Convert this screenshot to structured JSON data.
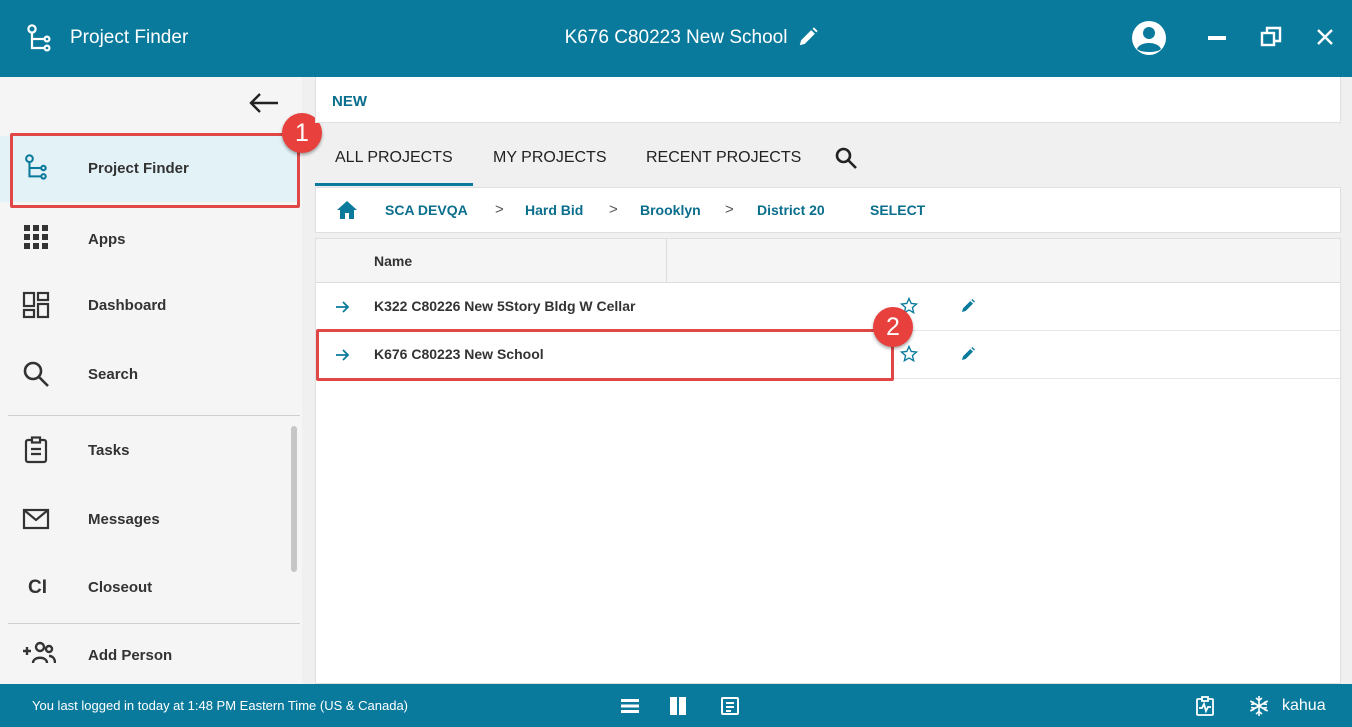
{
  "titlebar": {
    "app_name": "Project Finder",
    "project_title": "K676 C80223 New School",
    "icons": [
      "project-finder-icon",
      "pencil-icon",
      "user-avatar-icon",
      "minimize-icon",
      "restore-icon",
      "close-icon"
    ]
  },
  "sidebar": {
    "items": [
      {
        "label": "Project Finder",
        "icon": "project-finder-icon",
        "active": true
      },
      {
        "label": "Apps",
        "icon": "apps-grid-icon"
      },
      {
        "label": "Dashboard",
        "icon": "dashboard-icon"
      },
      {
        "label": "Search",
        "icon": "search-icon"
      },
      {
        "label": "Tasks",
        "icon": "clipboard-icon"
      },
      {
        "label": "Messages",
        "icon": "envelope-icon"
      },
      {
        "label": "Closeout",
        "icon": "closeout-icon",
        "icon_text": "CI"
      },
      {
        "label": "Add Person",
        "icon": "add-person-icon"
      }
    ]
  },
  "annotations": {
    "badge_1": "1",
    "badge_2": "2",
    "color": "#e04848"
  },
  "main": {
    "new_button": "NEW",
    "tabs": [
      {
        "label": "ALL PROJECTS",
        "active": true
      },
      {
        "label": "MY PROJECTS"
      },
      {
        "label": "RECENT PROJECTS"
      }
    ],
    "breadcrumb": {
      "items": [
        "SCA DEVQA",
        "Hard Bid",
        "Brooklyn",
        "District 20"
      ],
      "separator": ">",
      "select_label": "SELECT"
    },
    "grid": {
      "column_name": "Name",
      "rows": [
        {
          "name": "K322 C80226 New 5Story Bldg W Cellar"
        },
        {
          "name": "K676 C80223 New School"
        }
      ]
    }
  },
  "statusbar": {
    "login_text": "You last logged in today at 1:48 PM Eastern Time (US & Canada)",
    "brand": "kahua"
  },
  "colors": {
    "brand_teal": "#0a7a9c",
    "link_teal": "#0a6e8c",
    "annotation_red": "#e8403d"
  }
}
